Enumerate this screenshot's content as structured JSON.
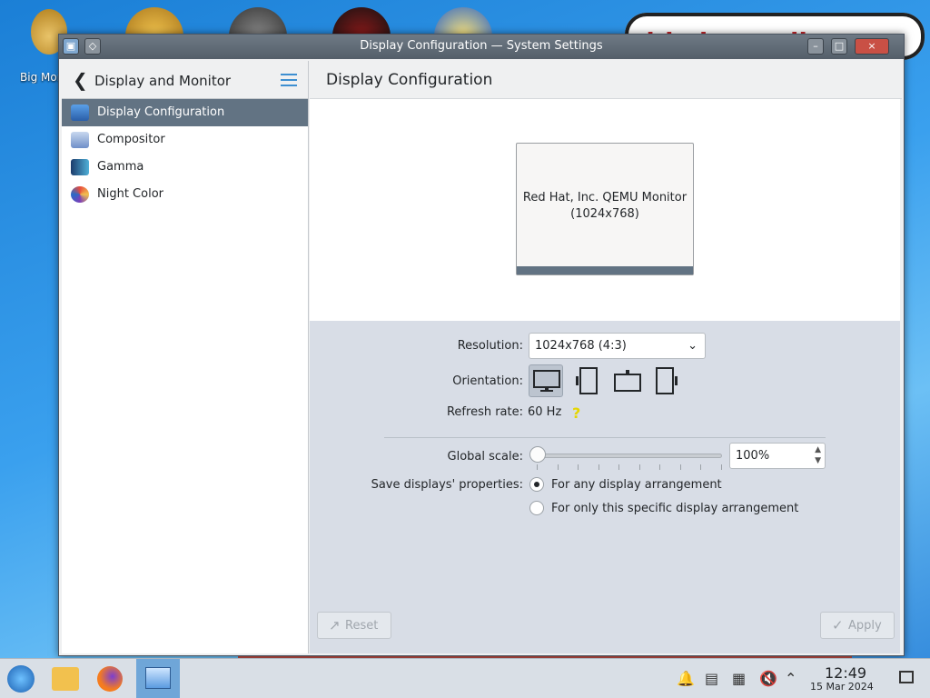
{
  "desktop": {
    "icon_label": "Big Money Deluxe",
    "note_text": "this is totally"
  },
  "window": {
    "title": "Display Configuration — System Settings",
    "minimize": "–",
    "maximize": "□",
    "close": "×"
  },
  "sidebar": {
    "back_symbol": "❮",
    "header": "Display and Monitor",
    "items": [
      {
        "label": "Display Configuration",
        "active": true
      },
      {
        "label": "Compositor"
      },
      {
        "label": "Gamma"
      },
      {
        "label": "Night Color"
      }
    ]
  },
  "main": {
    "page_title": "Display Configuration",
    "monitor": {
      "name": "Red Hat, Inc. QEMU Monitor",
      "resolution": "(1024x768)"
    },
    "resolution_label": "Resolution:",
    "resolution_value": "1024x768 (4:3)",
    "orientation_label": "Orientation:",
    "refresh_label": "Refresh rate:",
    "refresh_value": "60 Hz",
    "help_symbol": "?",
    "scale_label": "Global scale:",
    "scale_value": "100%",
    "scale_level": 0,
    "save_label": "Save displays' properties:",
    "save_options": [
      {
        "label": "For any display arrangement",
        "selected": true
      },
      {
        "label": "For only this specific display arrangement",
        "selected": false
      }
    ],
    "reset_label": "Reset",
    "apply_label": "Apply"
  },
  "taskbar": {
    "time": "12:49",
    "date": "15 Mar 2024"
  },
  "colors": {
    "accent": "#3d8fd1",
    "selection": "#627383"
  }
}
